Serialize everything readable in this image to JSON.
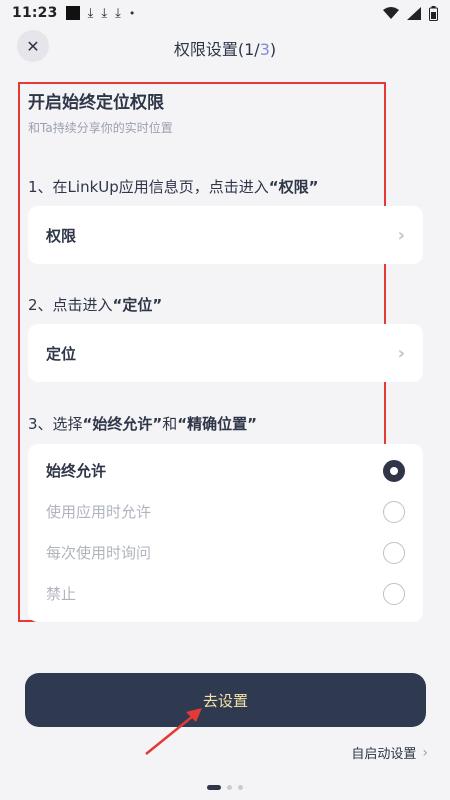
{
  "status_bar": {
    "time": "11:23",
    "icons": [
      "square-icon",
      "download-icon",
      "download-icon",
      "download-icon",
      "dot-icon",
      "wifi-icon",
      "signal-icon",
      "battery-icon"
    ]
  },
  "header": {
    "title": "权限设置(1/",
    "step_current": "3",
    "title_end": ")",
    "close_icon": "close-icon"
  },
  "main": {
    "title": "开启始终定位权限",
    "subtitle": "和Ta持续分享你的实时位置",
    "step1_prefix": "1、在LinkUp应用信息页，点击进入",
    "step1_bold": "“权限”",
    "card1_label": "权限",
    "step2_prefix": "2、点击进入",
    "step2_bold": "“定位”",
    "card2_label": "定位",
    "step3_prefix": "3、选择",
    "step3_bold1": "“始终允许”",
    "step3_mid": "和",
    "step3_bold2": "“精确位置”",
    "options": [
      {
        "label": "始终允许",
        "selected": true
      },
      {
        "label": "使用应用时允许",
        "selected": false
      },
      {
        "label": "每次使用时询问",
        "selected": false
      },
      {
        "label": "禁止",
        "selected": false
      }
    ]
  },
  "footer": {
    "go_button": "去设置",
    "autostart_link": "自启动设置",
    "pager_active": 1,
    "pager_total": 3
  },
  "colors": {
    "primary": "#2f3a50",
    "button_text": "#f3e3a6",
    "highlight_frame": "#e53935",
    "step_accent": "#7c8fcf"
  }
}
